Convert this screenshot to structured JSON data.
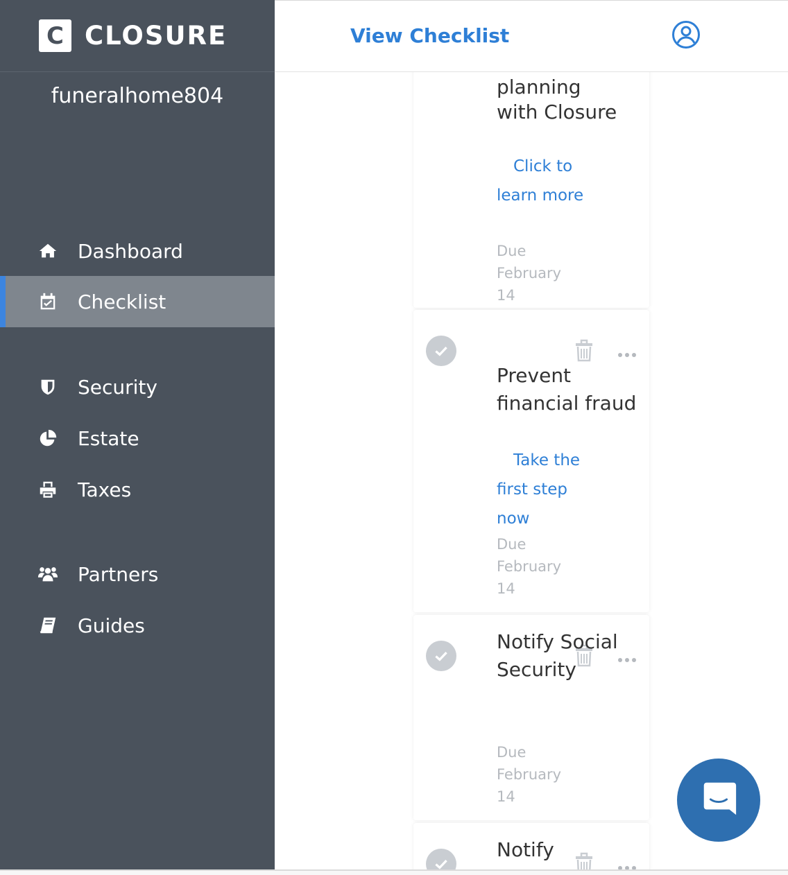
{
  "brand": {
    "logo_letter": "C",
    "name": "CLOSURE"
  },
  "user": {
    "name": "funeralhome804"
  },
  "nav": {
    "dashboard": "Dashboard",
    "checklist": "Checklist",
    "security": "Security",
    "estate": "Estate",
    "taxes": "Taxes",
    "partners": "Partners",
    "guides": "Guides"
  },
  "header": {
    "title": "View Checklist"
  },
  "tasks": [
    {
      "title_partial": "planning",
      "title": "with Closure",
      "link": "Click to learn more",
      "due": "Due February 14"
    },
    {
      "title": "Prevent financial fraud",
      "link": "Take the first step now",
      "due": "Due February 14"
    },
    {
      "title": "Notify Social Security",
      "link": "",
      "due": "Due February 14"
    },
    {
      "title": "Notify"
    }
  ],
  "colors": {
    "sidebar_bg": "#4a525c",
    "active_bg": "#7f868e",
    "accent": "#3d85df",
    "link": "#2e7fd6",
    "chat_bg": "#2e6fb0"
  },
  "icons": {
    "nav": [
      "home-icon",
      "calendar-check-icon",
      "shield-icon",
      "pie-chart-icon",
      "printer-icon",
      "users-icon",
      "book-icon"
    ],
    "task": [
      "check-circle-icon",
      "trash-icon",
      "more-icon"
    ],
    "header": "user-circle-icon",
    "chat": "chat-icon"
  }
}
